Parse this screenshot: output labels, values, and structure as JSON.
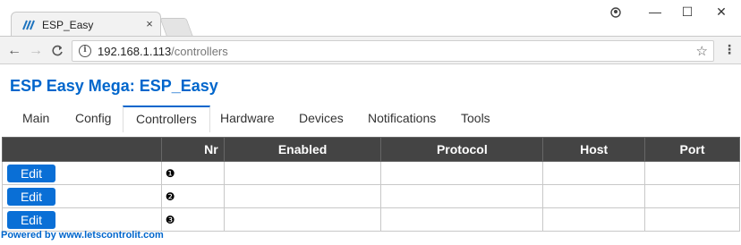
{
  "browser": {
    "tab_title": "ESP_Easy",
    "close_glyph": "×",
    "url_host": "192.168.1.113",
    "url_path": "/controllers",
    "window_controls": {
      "profile": "●",
      "minimize": "—",
      "maximize": "☐",
      "close": "✕"
    },
    "nav": {
      "back": "←",
      "forward": "→",
      "reload": "C"
    },
    "star_glyph": "☆",
    "menu_glyph": "⋮",
    "info_glyph": "i"
  },
  "page": {
    "title": "ESP Easy Mega: ESP_Easy",
    "menu": [
      {
        "label": "Main",
        "active": false
      },
      {
        "label": "Config",
        "active": false
      },
      {
        "label": "Controllers",
        "active": true
      },
      {
        "label": "Hardware",
        "active": false
      },
      {
        "label": "Devices",
        "active": false
      },
      {
        "label": "Notifications",
        "active": false
      },
      {
        "label": "Tools",
        "active": false
      }
    ],
    "table": {
      "headers": [
        "",
        "Nr",
        "Enabled",
        "Protocol",
        "Host",
        "Port"
      ],
      "rows": [
        {
          "action": "Edit",
          "nr": "❶",
          "enabled": "",
          "protocol": "",
          "host": "",
          "port": ""
        },
        {
          "action": "Edit",
          "nr": "❷",
          "enabled": "",
          "protocol": "",
          "host": "",
          "port": ""
        },
        {
          "action": "Edit",
          "nr": "❸",
          "enabled": "",
          "protocol": "",
          "host": "",
          "port": ""
        }
      ]
    },
    "footer": "Powered by www.letscontrolit.com"
  },
  "colors": {
    "accent": "#0066cc",
    "button": "#0a6fd6",
    "header_bg": "#444444"
  }
}
